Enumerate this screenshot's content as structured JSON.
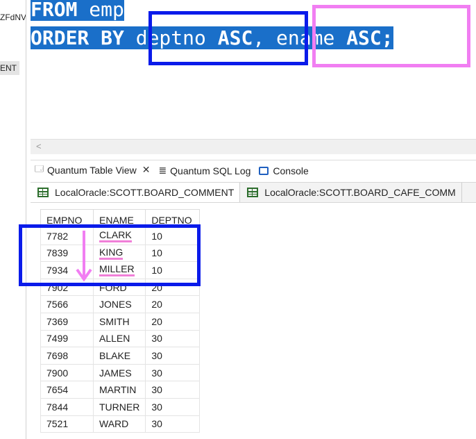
{
  "left_panel": {
    "fragment_1": "ZFdNV",
    "fragment_2": "ENT"
  },
  "editor": {
    "line1": {
      "keyword": "FROM",
      "rest": " emp"
    },
    "line2": {
      "keyword1": "ORDER BY",
      "col1": "deptno",
      "kw_asc1": "ASC",
      "comma": ",",
      "col2": "ename",
      "kw_asc2": "ASC",
      "semicolon": ";"
    },
    "scroll_arrow": "<"
  },
  "view_tabs": [
    {
      "label": "Quantum Table View",
      "icon": "table-view-icon",
      "closable": true
    },
    {
      "label": "Quantum SQL Log",
      "icon": "sql-log-icon"
    },
    {
      "label": "Console",
      "icon": "console-icon"
    }
  ],
  "result_tabs": [
    {
      "label": "LocalOracle:SCOTT.BOARD_COMMENT",
      "icon": "table-icon"
    },
    {
      "label": "LocalOracle:SCOTT.BOARD_CAFE_COMM",
      "icon": "table-icon"
    }
  ],
  "grid": {
    "columns": [
      "EMPNO",
      "ENAME",
      "DEPTNO"
    ],
    "rows": [
      [
        "7782",
        "CLARK",
        "10"
      ],
      [
        "7839",
        "KING",
        "10"
      ],
      [
        "7934",
        "MILLER",
        "10"
      ],
      [
        "7902",
        "FORD",
        "20"
      ],
      [
        "7566",
        "JONES",
        "20"
      ],
      [
        "7369",
        "SMITH",
        "20"
      ],
      [
        "7499",
        "ALLEN",
        "30"
      ],
      [
        "7698",
        "BLAKE",
        "30"
      ],
      [
        "7900",
        "JAMES",
        "30"
      ],
      [
        "7654",
        "MARTIN",
        "30"
      ],
      [
        "7844",
        "TURNER",
        "30"
      ],
      [
        "7521",
        "WARD",
        "30"
      ]
    ],
    "underlined_rows": [
      0,
      1,
      2
    ]
  },
  "colors": {
    "selection": "#1a6fc9",
    "annotation_blue": "#0a1bea",
    "annotation_pink": "#f17ef2"
  }
}
